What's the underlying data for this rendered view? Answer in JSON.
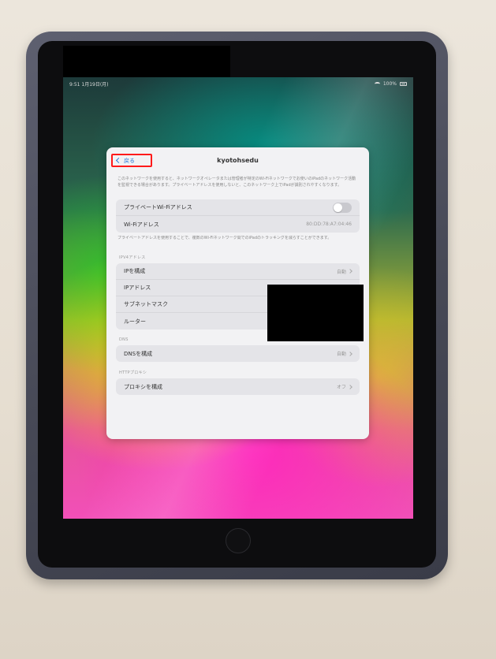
{
  "status_bar": {
    "time_date": "9:51 1月19日(月)",
    "battery": "100%"
  },
  "sheet": {
    "back_label": "戻る",
    "title": "kyotohsedu",
    "intro": "このネットワークを使用すると、ネットワークオペレータまたは管理者が特定のWi-Fiネットワークでお使いのiPadのネットワーク活動を監視できる場合があります。プライベートアドレスを使用しないと、このネットワーク上でiPadが識別されやすくなります。",
    "private_address_label": "プライベートWi-Fiアドレス",
    "wifi_address_label": "Wi-Fiアドレス",
    "wifi_address_value": "80:DD:78:A7:04:46",
    "private_footnote": "プライベートアドレスを使用することで、複数のWi-Fiネットワーク間でのiPadのトラッキングを減らすことができます。",
    "ipv4_header": "IPV4アドレス",
    "ip_config_label": "IPを構成",
    "ip_config_value": "自動",
    "ip_address_label": "IPアドレス",
    "subnet_label": "サブネットマスク",
    "router_label": "ルーター",
    "dns_header": "DNS",
    "dns_label": "DNSを構成",
    "dns_value": "自動",
    "proxy_header": "HTTPプロキシ",
    "proxy_label": "プロキシを構成",
    "proxy_value": "オフ"
  },
  "colors": {
    "highlight_box": "#ff1a1a",
    "link_blue": "#2a7ad8",
    "case": "#474956",
    "orange_tab": "#f1541a"
  }
}
